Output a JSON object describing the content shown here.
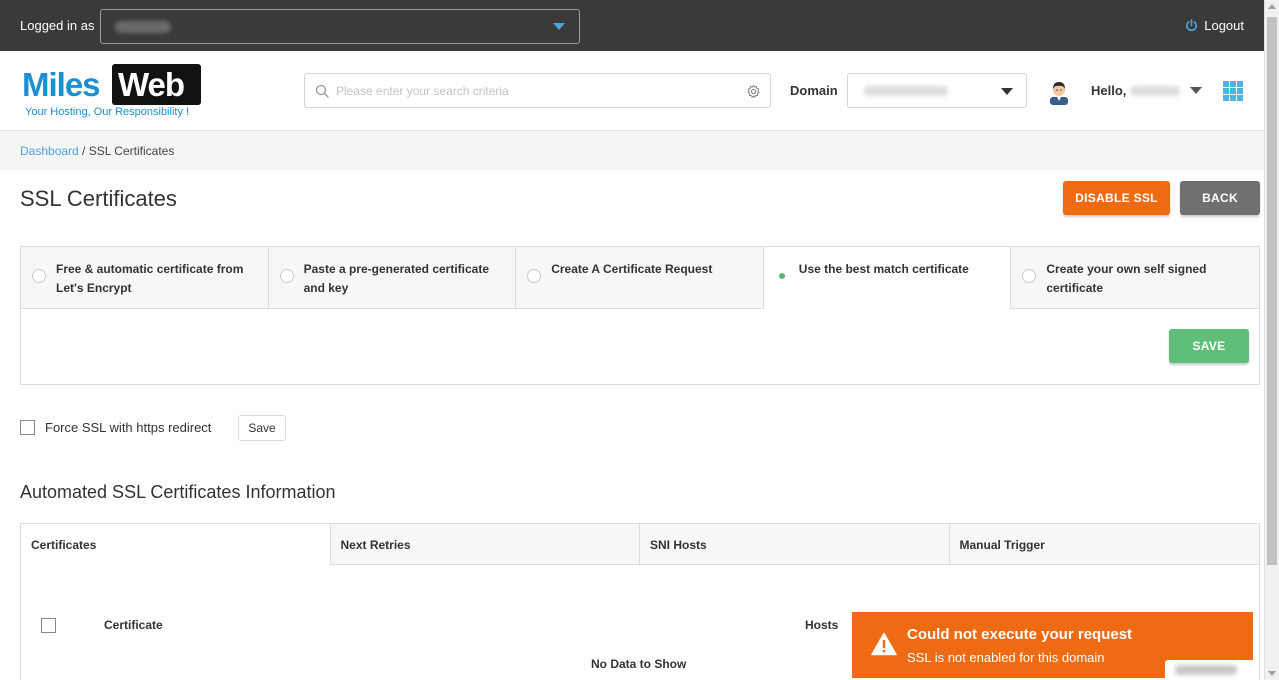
{
  "topbar": {
    "logged_in_label": "Logged in as",
    "logout_label": "Logout"
  },
  "header": {
    "logo_left": "Miles",
    "logo_right": "Web",
    "logo_tagline": "Your Hosting, Our Responsibility !",
    "search_placeholder": "Please enter your search criteria",
    "domain_label": "Domain",
    "hello_label": "Hello,"
  },
  "breadcrumb": {
    "root": "Dashboard",
    "separator": " / ",
    "current": "SSL Certificates"
  },
  "page": {
    "title": "SSL Certificates",
    "disable_ssl_label": "DISABLE SSL",
    "back_label": "BACK"
  },
  "options": {
    "items": [
      {
        "label": "Free & automatic certificate from Let's Encrypt",
        "selected": false
      },
      {
        "label": "Paste a pre-generated certificate and key",
        "selected": false
      },
      {
        "label": "Create A Certificate Request",
        "selected": false
      },
      {
        "label": "Use the best match certificate",
        "selected": true
      },
      {
        "label": "Create your own self signed certificate",
        "selected": false
      }
    ],
    "save_label": "SAVE"
  },
  "force_ssl": {
    "label": "Force SSL with https redirect",
    "save_label": "Save"
  },
  "automated": {
    "title": "Automated SSL Certificates Information",
    "tabs": [
      "Certificates",
      "Next Retries",
      "SNI Hosts",
      "Manual Trigger"
    ],
    "columns": {
      "certificate": "Certificate",
      "hosts": "Hosts"
    },
    "empty_message": "No Data to Show"
  },
  "toast": {
    "title": "Could not execute your request",
    "message": "SSL is not enabled for this domain"
  },
  "colors": {
    "accent_orange": "#ee6b13",
    "accent_blue": "#4aa3df",
    "save_green": "#5fbf7a",
    "topbar_bg": "#3a3a3a"
  }
}
